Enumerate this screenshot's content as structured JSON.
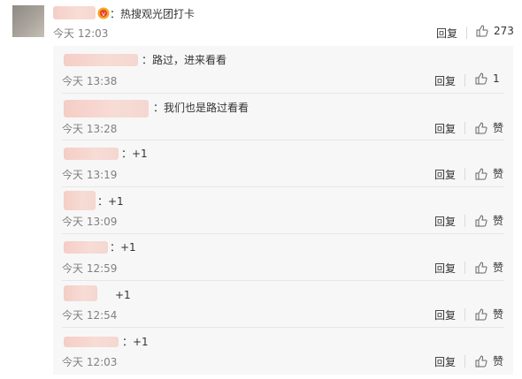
{
  "main_comment": {
    "text": "：热搜观光团打卡",
    "time": "今天 12:03",
    "reply_label": "回复",
    "like_count": "273"
  },
  "replies": [
    {
      "text": "：路过，进来看看",
      "time": "今天 13:38",
      "reply_label": "回复",
      "like_label": "1"
    },
    {
      "text": "：我们也是路过看看",
      "time": "今天 13:28",
      "reply_label": "回复",
      "like_label": "赞"
    },
    {
      "text": "：+1",
      "time": "今天 13:19",
      "reply_label": "回复",
      "like_label": "赞"
    },
    {
      "text": "：+1",
      "time": "今天 13:09",
      "reply_label": "回复",
      "like_label": "赞"
    },
    {
      "text": "：+1",
      "time": "今天 12:59",
      "reply_label": "回复",
      "like_label": "赞"
    },
    {
      "text": "+1",
      "time": "今天 12:54",
      "reply_label": "回复",
      "like_label": "赞"
    },
    {
      "text": "：+1",
      "time": "今天 12:03",
      "reply_label": "回复",
      "like_label": "赞"
    }
  ],
  "icons": {
    "like": "thumbs-up-icon",
    "vip": "vip-badge-icon"
  },
  "colors": {
    "meta_text": "#808080",
    "panel_bg": "#f7f7f7",
    "redacted_name": "#f4c9c0"
  }
}
